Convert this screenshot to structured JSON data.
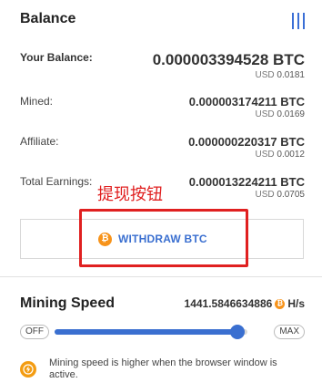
{
  "balance": {
    "title": "Balance",
    "menu_icon": "menu-bars-icon",
    "rows": [
      {
        "label": "Your Balance:",
        "btc": "0.000003394528 BTC",
        "usd_prefix": "USD",
        "usd": "0.0181"
      },
      {
        "label": "Mined:",
        "btc": "0.000003174211 BTC",
        "usd_prefix": "USD",
        "usd": "0.0169"
      },
      {
        "label": "Affiliate:",
        "btc": "0.000000220317 BTC",
        "usd_prefix": "USD",
        "usd": "0.0012"
      },
      {
        "label": "Total Earnings:",
        "btc": "0.000013224211 BTC",
        "usd_prefix": "USD",
        "usd": "0.0705"
      }
    ]
  },
  "annotation": {
    "text": "提现按钮",
    "color": "#e02020"
  },
  "withdraw": {
    "label": "WITHDRAW BTC",
    "icon": "bitcoin-coin-icon",
    "coin_symbol": "₿"
  },
  "mining": {
    "title": "Mining Speed",
    "speed_value": "1441.5846634886",
    "speed_unit": "H/s",
    "slider_min_label": "OFF",
    "slider_max_label": "MAX",
    "slider_level": 0.95,
    "info_text": "Mining speed is higher when the browser window is active.",
    "info_icon": "lightning-icon"
  },
  "colors": {
    "accent": "#3a6fd0",
    "coin": "#f7931a",
    "highlight": "#e02020"
  }
}
